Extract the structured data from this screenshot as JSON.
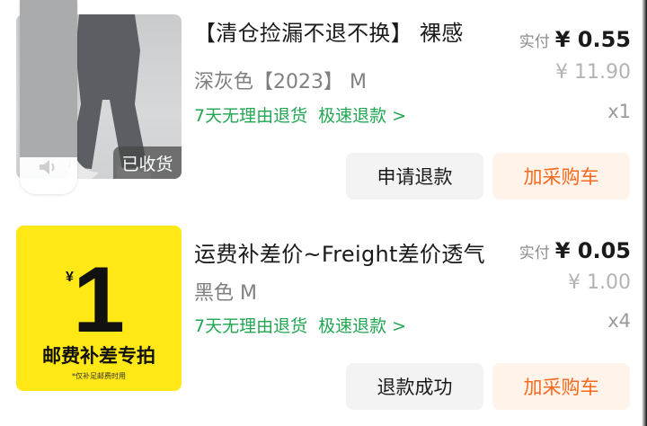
{
  "orders": [
    {
      "title": "【清仓捡漏不退不换】 裸感",
      "spec": "深灰色【2023】 M",
      "guarantee_1": "7天无理由退货",
      "guarantee_2": "极速退款",
      "guarantee_arrow": ">",
      "paid_label": "实付",
      "paid_amount": "¥ 0.55",
      "original_price": "¥ 11.90",
      "quantity": "x1",
      "thumb_badge": "已收货",
      "btn_left": "申请退款",
      "btn_right": "加采购车"
    },
    {
      "title": "运费补差价~Freight差价透气",
      "spec": "黑色 M",
      "guarantee_1": "7天无理由退货",
      "guarantee_2": "极速退款",
      "guarantee_arrow": ">",
      "paid_label": "实付",
      "paid_amount": "¥ 0.05",
      "original_price": "¥ 1.00",
      "quantity": "x4",
      "promo_currency": "¥",
      "promo_big": "1",
      "promo_text": "邮费补差专拍",
      "promo_small": "*仅补足邮费时用",
      "btn_left": "退款成功",
      "btn_right": "加采购车"
    }
  ],
  "colors": {
    "green": "#21a652",
    "orange": "#f66a1f",
    "promo_yellow": "#ffe816"
  },
  "icons": {
    "floating": "speaker-icon"
  }
}
